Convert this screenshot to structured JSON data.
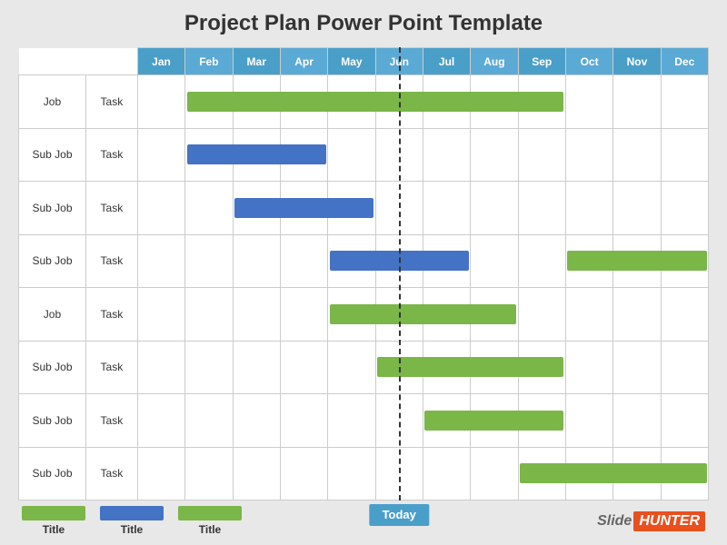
{
  "title": "Project Plan Power Point Template",
  "months": [
    "Jan",
    "Feb",
    "Mar",
    "Apr",
    "May",
    "Jun",
    "Jul",
    "Aug",
    "Sep",
    "Oct",
    "Nov",
    "Dec"
  ],
  "rows": [
    {
      "label": "Job",
      "task": "Task",
      "bar": {
        "color": "green",
        "start": 1,
        "span": 8
      }
    },
    {
      "label": "Sub Job",
      "task": "Task",
      "bar": {
        "color": "blue",
        "start": 1,
        "span": 3
      }
    },
    {
      "label": "Sub Job",
      "task": "Task",
      "bar": {
        "color": "blue",
        "start": 2,
        "span": 3
      }
    },
    {
      "label": "Sub Job",
      "task": "Task",
      "bar": {
        "color": "blue",
        "start": 4,
        "span": 3
      },
      "bar2": {
        "color": "green",
        "start": 9,
        "span": 3
      }
    },
    {
      "label": "Job",
      "task": "Task",
      "bar": {
        "color": "green",
        "start": 4,
        "span": 4
      }
    },
    {
      "label": "Sub Job",
      "task": "Task",
      "bar": {
        "color": "green",
        "start": 5,
        "span": 4
      }
    },
    {
      "label": "Sub Job",
      "task": "Task",
      "bar": {
        "color": "green",
        "start": 6,
        "span": 3
      }
    },
    {
      "label": "Sub Job",
      "task": "Task",
      "bar": {
        "color": "green",
        "start": 8,
        "span": 4
      }
    }
  ],
  "today_label": "Today",
  "today_col": 5,
  "legend": [
    {
      "color": "#7ab648",
      "label": "Title"
    },
    {
      "color": "#4472c4",
      "label": "Title"
    },
    {
      "color": "#7ab648",
      "label": "Title"
    }
  ],
  "branding": {
    "slide": "Slide",
    "hunter": "HUNTER"
  }
}
